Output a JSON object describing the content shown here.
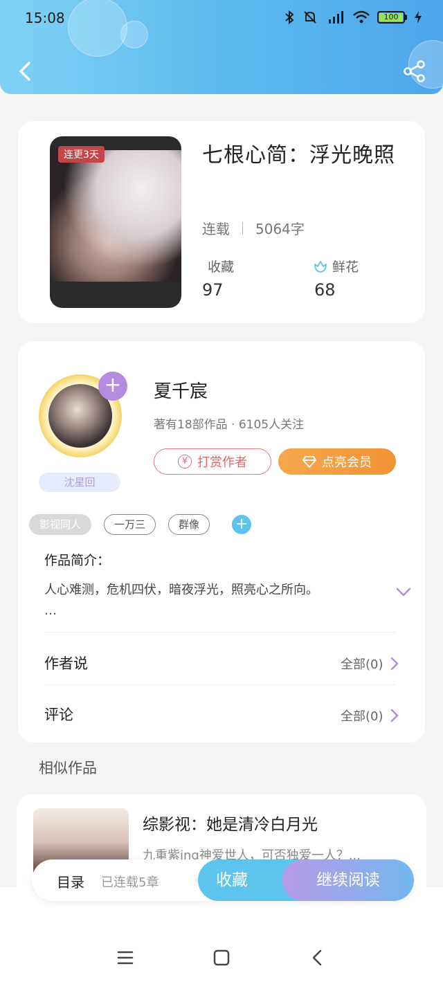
{
  "status_bar": {
    "time": "15:08",
    "battery": "100"
  },
  "colors": {
    "header_start": "#7fd2f3",
    "header_end": "#4ea6ec",
    "accent_blue": "#5ec4ee",
    "vip_orange": "#f19436",
    "tip_red": "#e06666",
    "badge_red": "#c1464a",
    "accent_purple": "#b48be0"
  },
  "icons": [
    "back-icon",
    "share-icon",
    "flower-icon",
    "plus-icon",
    "chevron-down-icon",
    "chevron-right-icon",
    "coin-icon",
    "diamond-icon",
    "menu-icon",
    "home-icon"
  ],
  "book": {
    "badge": "连更3天",
    "title": "七根心简：浮光晚照",
    "status": "连载",
    "word_count": "5064字",
    "collect_label": "收藏",
    "collect_value": "97",
    "flower_label": "鲜花",
    "flower_value": "68"
  },
  "author": {
    "name": "夏千宸",
    "meta": "著有18部作品 · 6105人关注",
    "avatar_tag": "沈星回",
    "tip_button": "打赏作者",
    "vip_button": "点亮会员",
    "follow_plus": "+"
  },
  "tags": [
    "影视同人",
    "一万三",
    "群像"
  ],
  "tag_add": "+",
  "intro": {
    "title": "作品简介：",
    "text": "人心难测，危机四伏，暗夜浮光，照亮心之所向。",
    "ellipsis": "…"
  },
  "rows": [
    {
      "label": "作者说",
      "right": "全部(0)"
    },
    {
      "label": "评论",
      "right": "全部(0)"
    }
  ],
  "similar": {
    "section_title": "相似作品",
    "items": [
      {
        "title": "综影视：她是清冷白月光",
        "desc": "九重紫ing神爱世人，可否独爱一人？..."
      }
    ]
  },
  "action_bar": {
    "toc": "目录",
    "toc_sub": "已连载5章",
    "collect": "收藏",
    "read": "继续阅读"
  }
}
